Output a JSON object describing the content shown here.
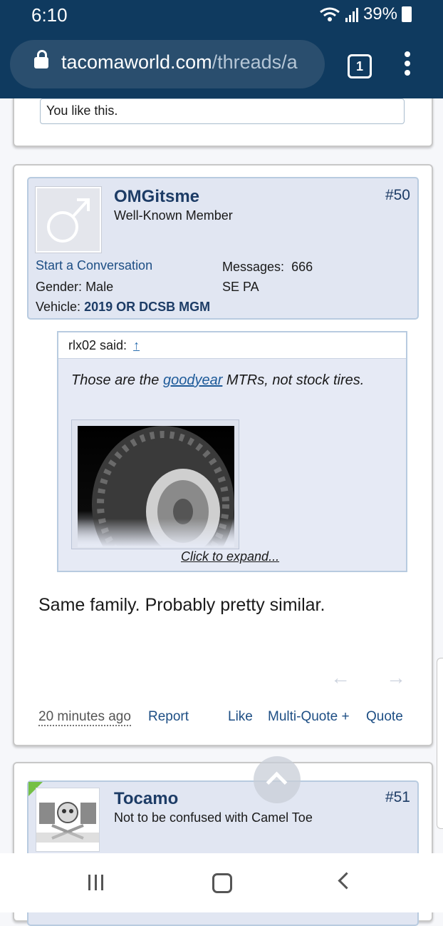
{
  "status": {
    "time": "6:10",
    "battery": "39%"
  },
  "browser": {
    "url_host": "tacomaworld.com",
    "url_path": "/threads/a",
    "tab_count": "1"
  },
  "prev_post": {
    "likes_text": "You like this."
  },
  "post": {
    "username": "OMGitsme",
    "user_title": "Well-Known Member",
    "post_number": "#50",
    "start_conversation": "Start a Conversation",
    "gender_label": "Gender:",
    "gender_value": "Male",
    "vehicle_label": "Vehicle:",
    "vehicle_value": "2019 OR DCSB MGM",
    "messages_label": "Messages:",
    "messages_value": "666",
    "location": "SE PA",
    "quote": {
      "author": "rlx02 said:",
      "up_link": "↑",
      "text_before": "Those are the ",
      "link_text": "goodyear",
      "text_after": " MTRs, not stock tires.",
      "expand": "Click to expand..."
    },
    "body": "Same family. Probably pretty similar.",
    "footer": {
      "time": "20 minutes ago",
      "report": "Report",
      "like": "Like",
      "multiquote": "Multi-Quote +",
      "quote": "Quote"
    }
  },
  "next_post": {
    "username": "Tocamo",
    "user_title": "Not to be confused with Camel Toe",
    "post_number": "#51"
  },
  "icons": [
    "lock-icon",
    "tabs-icon",
    "menu-icon",
    "male-avatar-icon",
    "prev-arrow-icon",
    "next-arrow-icon",
    "scroll-top-icon"
  ],
  "colors": {
    "topbar": "#0f3a5f",
    "accent": "#1d3c66",
    "online": "#74c045"
  }
}
